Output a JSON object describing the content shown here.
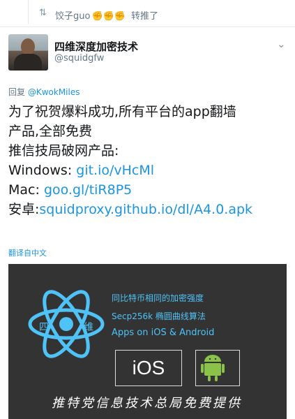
{
  "retweet": {
    "user": "饺子guo",
    "emojis": "✊✊✊",
    "action": "转推了"
  },
  "tweet": {
    "display_name": "四维深度加密技术",
    "handle": "@squidgfw",
    "reply_prefix": "回复",
    "reply_to": "@KwokMiles",
    "text_line1": "为了祝贺爆料成功,所有平台的app翻墙",
    "text_line2": "产品,全部免费",
    "text_line3": "推信技局破网产品:",
    "windows_label": "Windows: ",
    "windows_link": "git.io/vHcMl",
    "mac_label": "Mac: ",
    "mac_link": "goo.gl/tiR8P5",
    "android_label": "安卓:",
    "android_link": "squidproxy.github.io/dl/A4.0.apk",
    "translate_label": "翻译自中文"
  },
  "card": {
    "atom_left": "四",
    "atom_right": "维",
    "line1": "同比特币相同的加密强度",
    "line2": "Secp256k 椭圆曲线算法",
    "line3": "Apps on iOS & Android",
    "ios_label": "iOS",
    "footer": "推特党信息技术总局免费提供",
    "accent_color": "#4fc3f7",
    "android_color": "#8bc34a"
  },
  "icons": {
    "retweet": "retweet-icon",
    "chevron": "chevron-down-icon"
  }
}
